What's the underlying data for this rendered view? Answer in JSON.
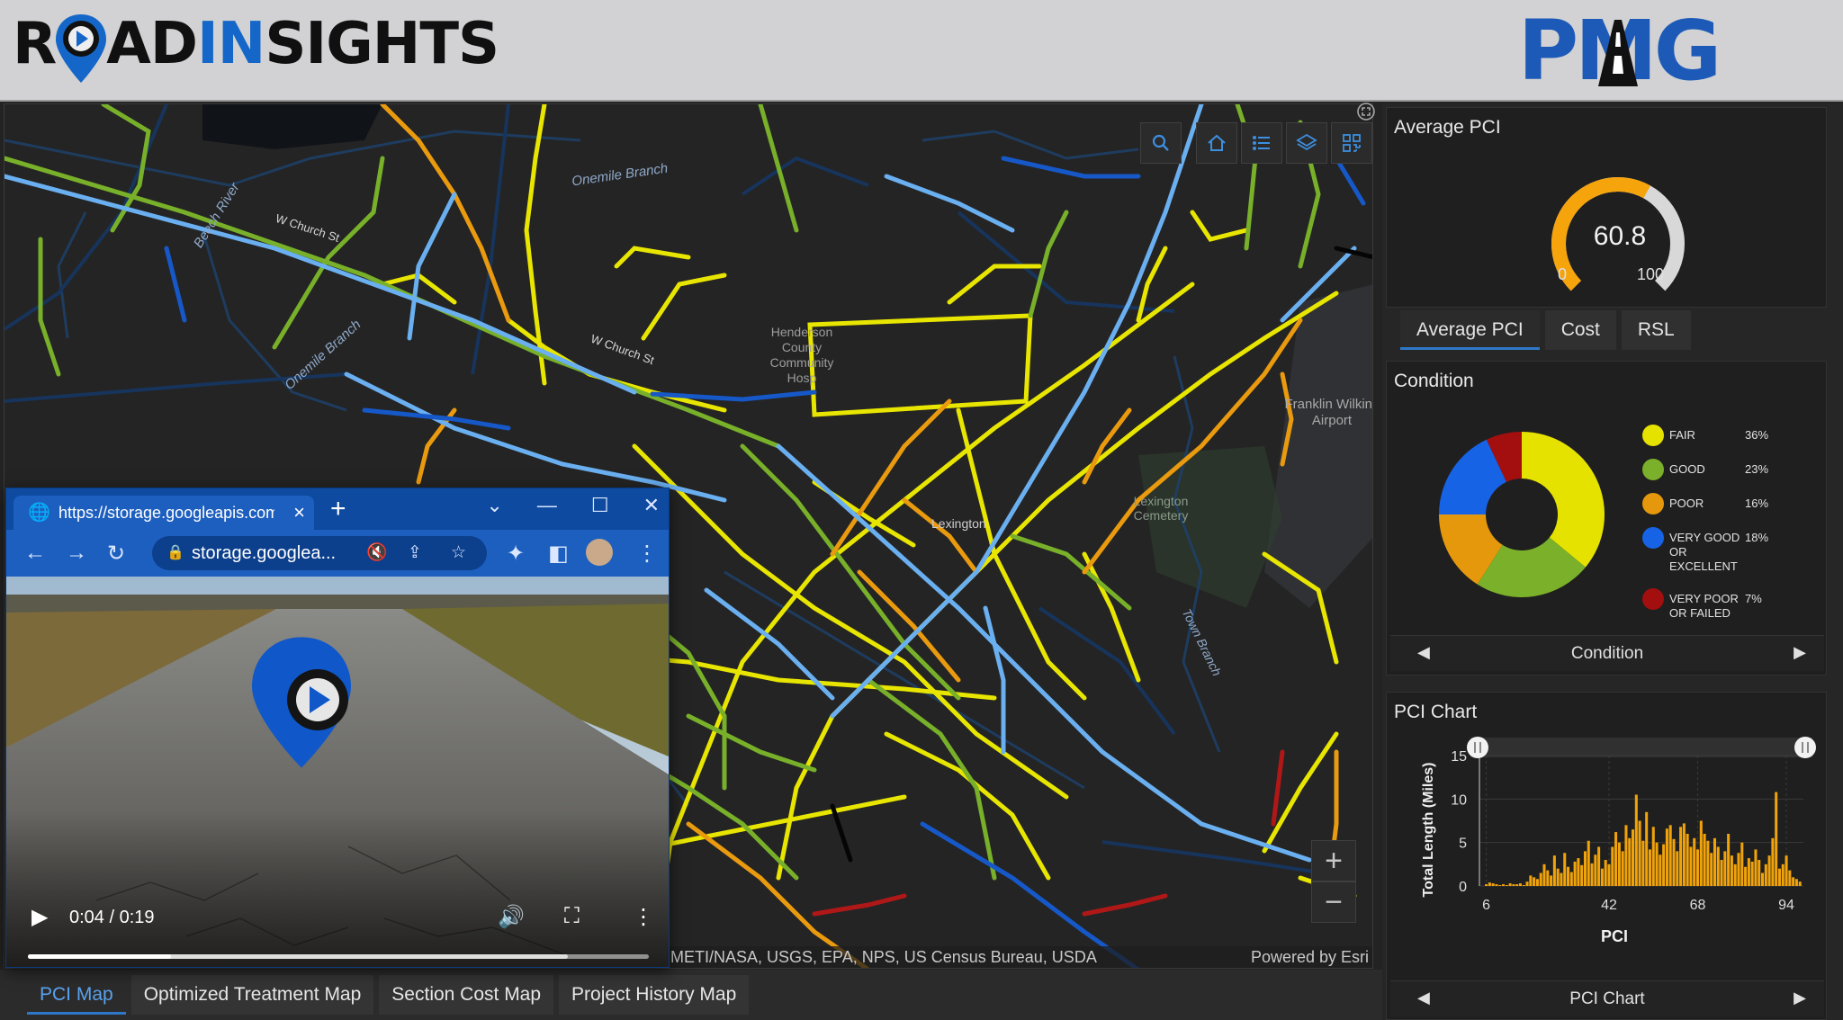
{
  "header": {
    "brand_prefix": "R",
    "brand_mid": "AD",
    "brand_in": "IN",
    "brand_suffix": "SIGHTS",
    "partner_logo": "PMG",
    "brand_color": "#1467c8",
    "partner_color": "#1d5ab8"
  },
  "map": {
    "labels": {
      "onemile_branch_1": "Onemile Branch",
      "onemile_branch_2": "Onemile Branch",
      "beech_river": "Beech River",
      "w_church_st_1": "W Church St",
      "w_church_st_2": "W Church St",
      "hospital": "Henderson County Community Hosp",
      "airport": "Franklin Wilkins Airport",
      "cemetery": "Lexington Cemetery",
      "town_branch": "Town Branch",
      "lexington": "Lexington"
    },
    "toolbar": [
      "search-icon",
      "home-icon",
      "list-icon",
      "layers-icon",
      "qr-icon"
    ],
    "zoom_in": "+",
    "zoom_out": "−",
    "attribution_sources": "METI/NASA, USGS, EPA, NPS, US Census Bureau, USDA",
    "attribution_esri": "Powered by Esri"
  },
  "bottom_tabs": [
    {
      "label": "PCI Map",
      "active": true
    },
    {
      "label": "Optimized Treatment Map",
      "active": false
    },
    {
      "label": "Section Cost Map",
      "active": false
    },
    {
      "label": "Project History Map",
      "active": false
    }
  ],
  "average_pci": {
    "title": "Average PCI",
    "value": "60.8",
    "fraction": 0.608,
    "min": "0",
    "max": "100",
    "tabs": [
      {
        "label": "Average PCI",
        "active": true
      },
      {
        "label": "Cost",
        "active": false
      },
      {
        "label": "RSL",
        "active": false
      }
    ]
  },
  "condition": {
    "title": "Condition",
    "nav_label": "Condition",
    "slices": [
      {
        "label": "FAIR",
        "pct": "36%",
        "value": 36,
        "color": "#e6e200"
      },
      {
        "label": "GOOD",
        "pct": "23%",
        "value": 23,
        "color": "#7ab02a"
      },
      {
        "label": "POOR",
        "pct": "16%",
        "value": 16,
        "color": "#e6980c"
      },
      {
        "label": "VERY GOOD OR EXCELLENT",
        "pct": "18%",
        "value": 18,
        "color": "#1763e6"
      },
      {
        "label": "VERY POOR OR FAILED",
        "pct": "7%",
        "value": 7,
        "color": "#a30f0f"
      }
    ]
  },
  "pci_chart": {
    "title": "PCI Chart",
    "nav_label": "PCI Chart"
  },
  "chart_data": {
    "type": "bar",
    "xlabel": "PCI",
    "ylabel": "Total Length (Miles)",
    "xlim": [
      0,
      100
    ],
    "ylim": [
      0,
      15
    ],
    "xticks": [
      "6",
      "42",
      "68",
      "94"
    ],
    "yticks": [
      "0",
      "5",
      "10",
      "15"
    ],
    "color": "#f0a30a",
    "x": [
      6,
      7,
      8,
      9,
      10,
      11,
      12,
      13,
      14,
      15,
      16,
      17,
      18,
      19,
      20,
      21,
      22,
      23,
      24,
      25,
      26,
      27,
      28,
      29,
      30,
      31,
      32,
      33,
      34,
      35,
      36,
      37,
      38,
      39,
      40,
      41,
      42,
      43,
      44,
      45,
      46,
      47,
      48,
      49,
      50,
      51,
      52,
      53,
      54,
      55,
      56,
      57,
      58,
      59,
      60,
      61,
      62,
      63,
      64,
      65,
      66,
      67,
      68,
      69,
      70,
      71,
      72,
      73,
      74,
      75,
      76,
      77,
      78,
      79,
      80,
      81,
      82,
      83,
      84,
      85,
      86,
      87,
      88,
      89,
      90,
      91,
      92,
      93,
      94,
      95,
      96,
      97,
      98
    ],
    "values": [
      0.2,
      0.4,
      0.3,
      0.2,
      0.1,
      0.2,
      0.1,
      0.3,
      0.2,
      0.2,
      0.3,
      0.1,
      0.5,
      1.2,
      1.0,
      0.8,
      1.5,
      2.5,
      1.8,
      1.2,
      3.5,
      2.0,
      1.5,
      3.8,
      2.2,
      1.6,
      2.8,
      3.2,
      2.4,
      4.0,
      5.2,
      2.6,
      3.6,
      4.5,
      2.0,
      3.0,
      2.5,
      4.5,
      6.2,
      5.0,
      4.0,
      7.0,
      5.5,
      6.5,
      10.5,
      7.5,
      5.2,
      8.5,
      4.2,
      6.8,
      5.0,
      3.6,
      4.8,
      6.6,
      7.0,
      5.4,
      4.0,
      6.8,
      7.2,
      6.0,
      4.5,
      5.5,
      4.2,
      7.5,
      6.0,
      5.2,
      3.8,
      5.5,
      4.5,
      3.0,
      4.0,
      6.0,
      3.5,
      2.5,
      3.8,
      5.0,
      2.2,
      3.2,
      2.8,
      4.2,
      3.0,
      1.5,
      2.5,
      3.5,
      5.5,
      10.8,
      2.0,
      2.5,
      3.5,
      1.8,
      1.0,
      0.8,
      0.5
    ]
  },
  "popup": {
    "tab_title": "https://storage.googleapis.com",
    "url": "storage.googlea...",
    "time": "0:04 / 0:19",
    "progress": 0.23,
    "buffered": 0.87
  }
}
